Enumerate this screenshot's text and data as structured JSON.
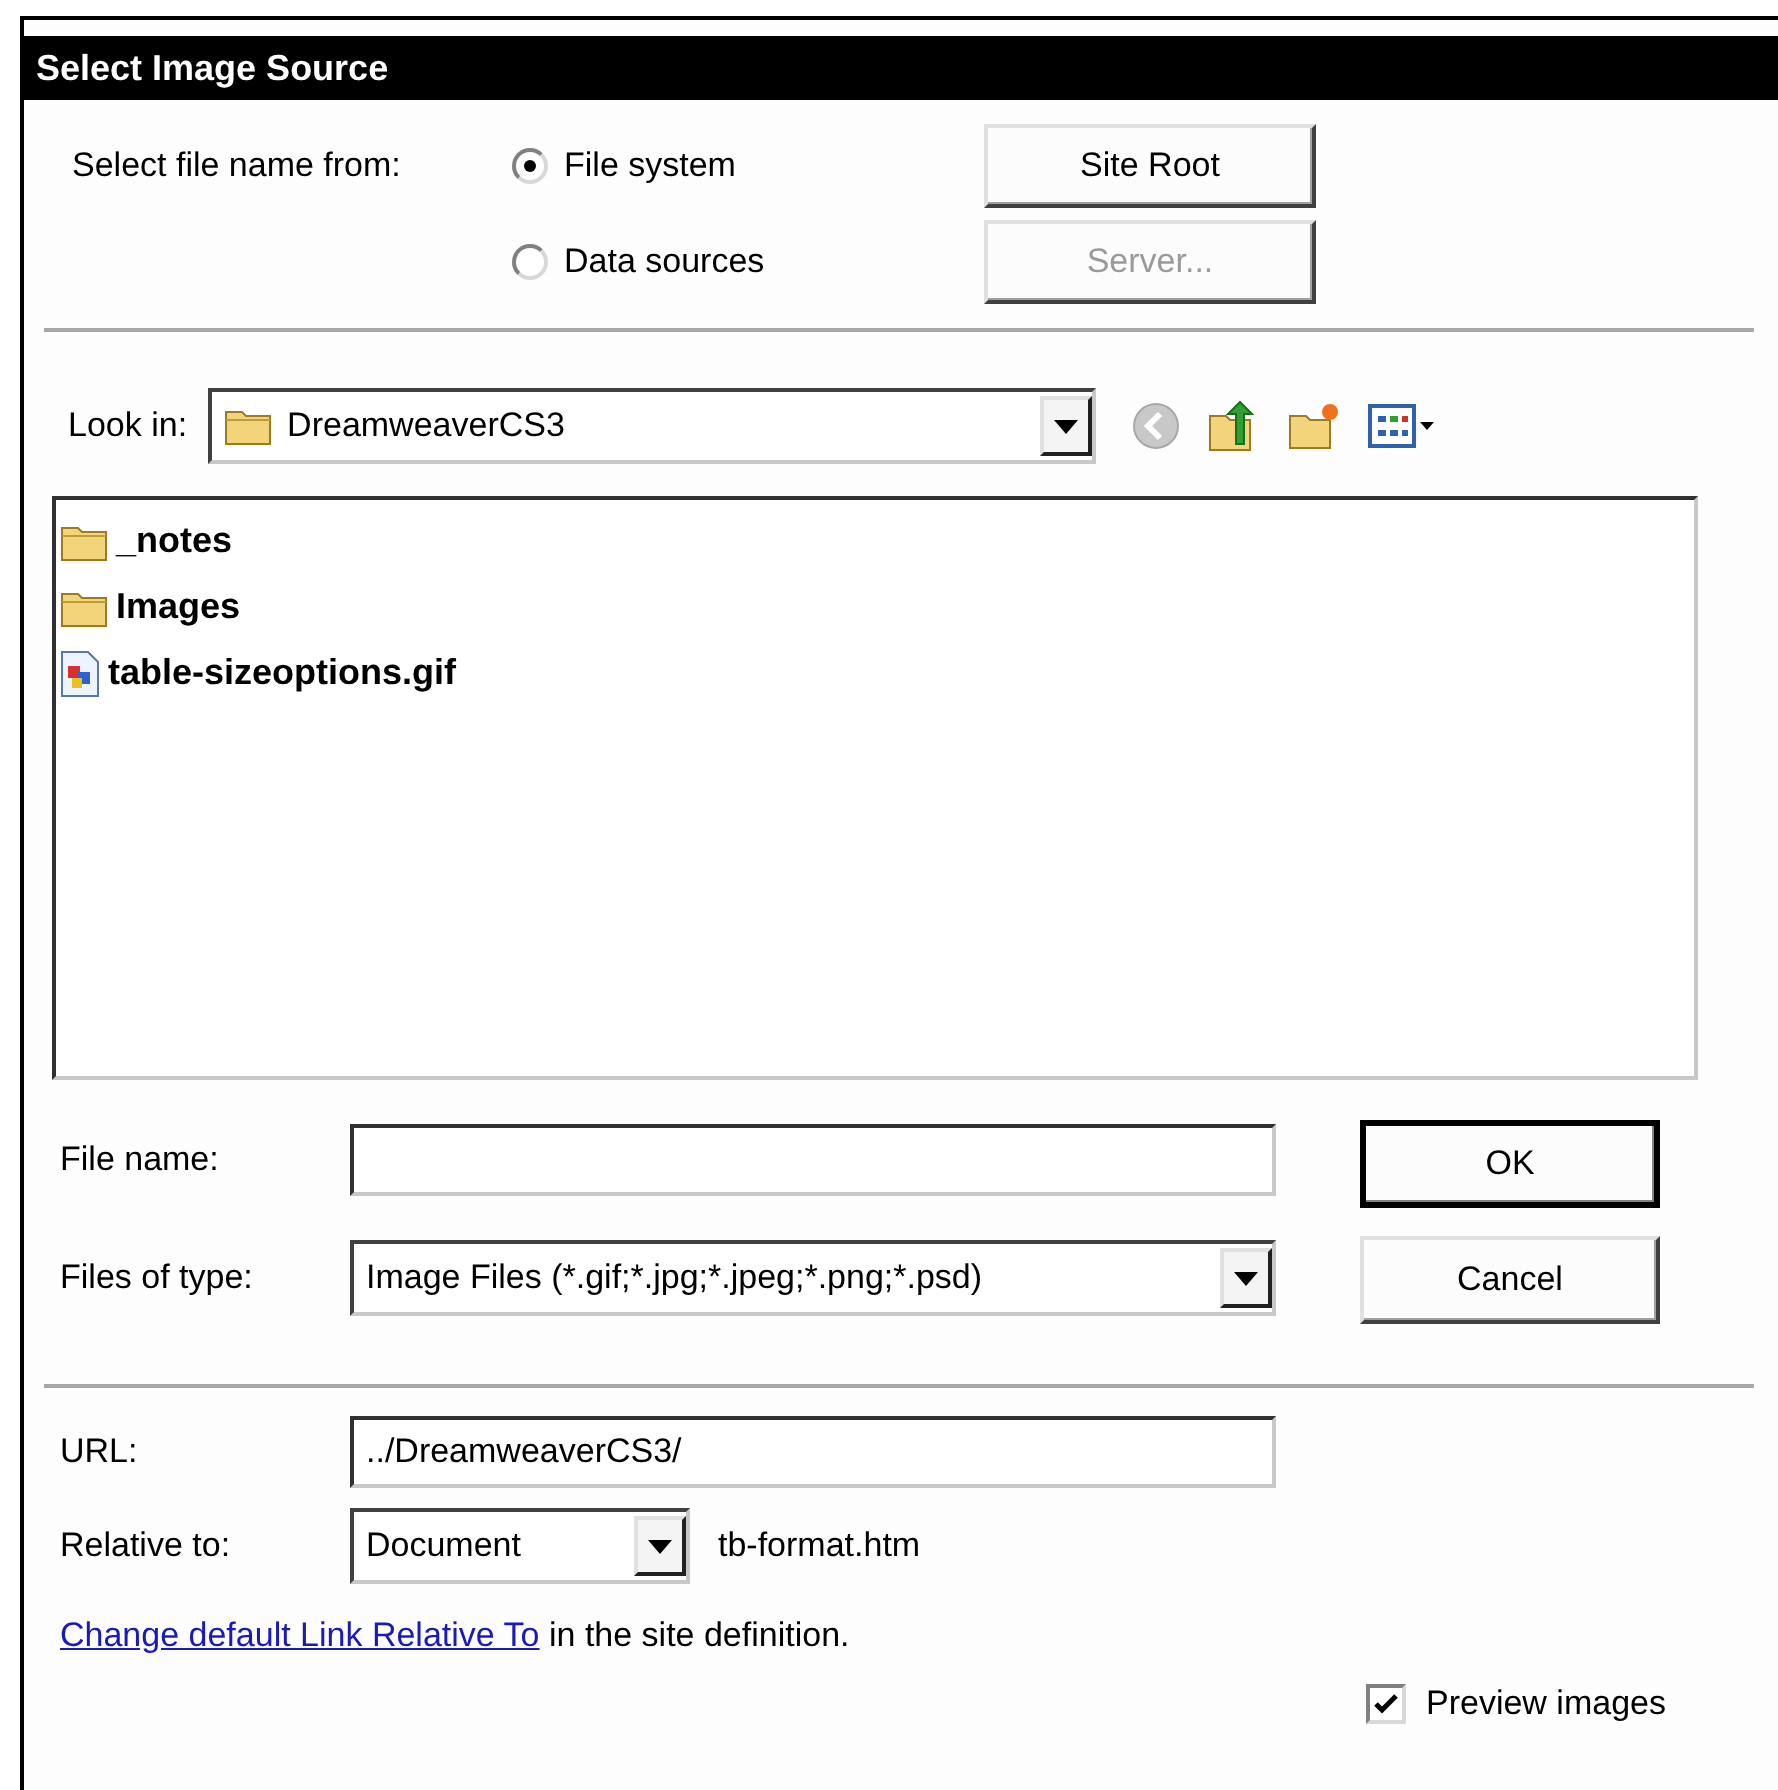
{
  "window": {
    "title": "Select Image Source"
  },
  "source": {
    "label": "Select file name from:",
    "options": [
      {
        "label": "File system",
        "selected": true
      },
      {
        "label": "Data sources",
        "selected": false
      }
    ]
  },
  "side_buttons": [
    {
      "label": "Site Root",
      "disabled": false
    },
    {
      "label": "Server...",
      "disabled": true
    }
  ],
  "look_in": {
    "label": "Look in:",
    "value": "DreamweaverCS3"
  },
  "files": [
    {
      "name": "_notes",
      "kind": "folder"
    },
    {
      "name": "Images",
      "kind": "folder"
    },
    {
      "name": "table-sizeoptions.gif",
      "kind": "image"
    }
  ],
  "file_name": {
    "label": "File name:"
  },
  "files_of_type": {
    "label": "Files of type:",
    "value": "Image Files (*.gif;*.jpg;*.jpeg;*.png;*.psd)"
  },
  "buttons": [
    {
      "label": "OK",
      "default": true
    },
    {
      "label": "Cancel",
      "default": false
    }
  ],
  "url": {
    "label": "URL:",
    "value": "../DreamweaverCS3/"
  },
  "relative_to": {
    "label": "Relative to:",
    "value": "Document",
    "file": "tb-format.htm"
  },
  "note": {
    "link": "Change default Link Relative To",
    "text": "in the site definition."
  },
  "preview": {
    "label": "Preview images",
    "checked": true
  }
}
